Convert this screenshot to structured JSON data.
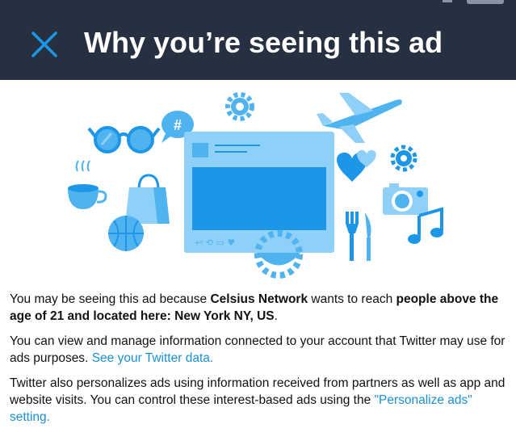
{
  "header": {
    "title": "Why you’re seeing this ad",
    "close_icon": "close-icon"
  },
  "illustration": {
    "accent_light": "#8fd0f8",
    "accent_mid": "#4fb3f0",
    "accent_dark": "#1d96e8",
    "icons": [
      "sunglasses-icon",
      "hashtag-bubble-icon",
      "gear-icon",
      "airplane-icon",
      "heart-icon",
      "camera-icon",
      "coffee-cup-icon",
      "shopping-bag-icon",
      "basketball-icon",
      "tweet-card-icon",
      "fork-knife-icon",
      "music-note-icon"
    ]
  },
  "body": {
    "p1": {
      "t1": "You may be seeing this ad because ",
      "advertiser": "Celsius Network",
      "t2": " wants to reach ",
      "audience": "people above the age of 21 and located here: New York NY, US",
      "t3": "."
    },
    "p2": {
      "text": "You can view and manage information connected to your account that Twitter may use for ads purposes. ",
      "link": "See your Twitter data."
    },
    "p3": {
      "text": "Twitter also personalizes ads using information received from partners as well as app and website visits. You can control these interest-based ads using the ",
      "link": "\"Personalize ads\" setting."
    }
  },
  "colors": {
    "header_bg": "#263040",
    "link": "#1b8fd6",
    "icon_blue": "#1d96e8"
  }
}
